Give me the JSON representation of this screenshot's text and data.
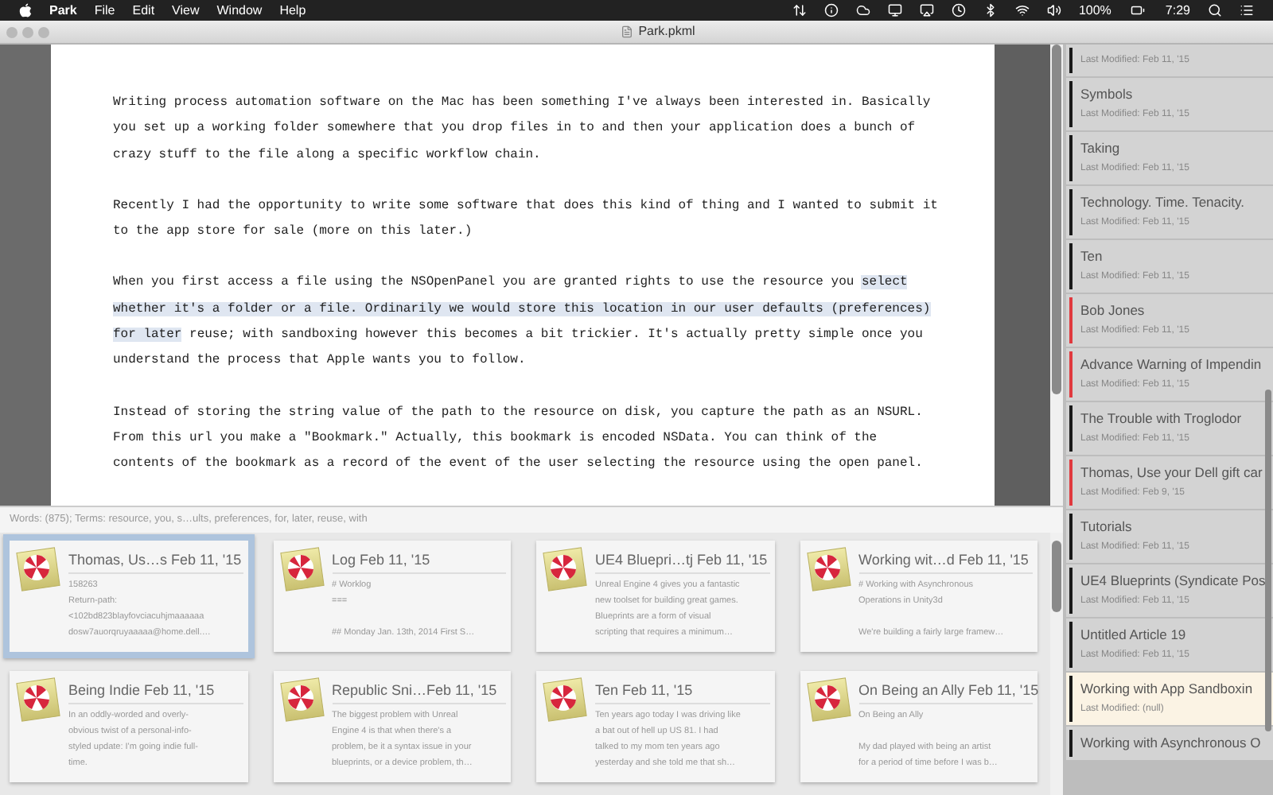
{
  "menu_bar": {
    "app_name": "Park",
    "menus": [
      "File",
      "Edit",
      "View",
      "Window",
      "Help"
    ],
    "battery": "100%",
    "clock": "7:29"
  },
  "window": {
    "title": "Park.pkml"
  },
  "editor": {
    "paragraphs": [
      [
        {
          "text": "Writing process automation software on the Mac has been something I've always been interested in. Basically you set up a working folder somewhere that you drop files in to and then your application does a bunch of crazy stuff to the file along a specific workflow chain.",
          "highlighted": false
        }
      ],
      [
        {
          "text": "Recently I had the opportunity to write some software that does this kind of thing and I wanted to submit it to the app store for sale (more on this later.)",
          "highlighted": false
        }
      ],
      [
        {
          "text": "When you first access a file using the NSOpenPanel you are granted rights to use the resource you ",
          "highlighted": false
        },
        {
          "text": "select whether it's a folder or a file. Ordinarily we would store this location in our user defaults (preferences) for later",
          "highlighted": true
        },
        {
          "text": " reuse; with sandboxing however this becomes a bit trickier. It's actually pretty simple once you understand the process that Apple wants you to follow.",
          "highlighted": false
        }
      ],
      [
        {
          "text": "Instead of storing the string value of the path to the resource on disk, you capture the path as an NSURL. From this url you make a \"Bookmark.\" Actually, this bookmark is encoded NSData. You can think of the contents of the bookmark as a record of the event of the user selecting the resource using the open panel.",
          "highlighted": false
        }
      ]
    ]
  },
  "status_bar": "Words: (875); Terms: resource, you, s…ults, preferences, for, later, reuse, with",
  "cards": [
    {
      "title": "Thomas, Us…s Feb 11, '15",
      "body": "158263\nReturn-path:\n<102bd823blayfovciacuhjmaaaaaa\ndosw7auorqruyaaaaa@home.dell.…",
      "selected": true
    },
    {
      "title": "Log Feb 11, '15",
      "body": "# Worklog\n===\n\n## Monday Jan. 13th, 2014 First S…",
      "selected": false
    },
    {
      "title": "UE4 Bluepri…tj Feb 11, '15",
      "body": "Unreal Engine 4 gives you a fantastic\nnew toolset for building great games.\nBlueprints are a form of visual\nscripting that requires a minimum…",
      "selected": false
    },
    {
      "title": "Working wit…d Feb 11, '15",
      "body": "# Working with Asynchronous\nOperations in Unity3d\n\nWe're building a fairly large framew…",
      "selected": false
    },
    {
      "title": "Being Indie Feb 11, '15",
      "body": "In an oddly-worded and overly-\nobvious twist of a personal-info-\nstyled update: I'm going indie full-\ntime.",
      "selected": false
    },
    {
      "title": "Republic Sni…Feb 11, '15",
      "body": "The biggest problem with Unreal\nEngine 4 is that when there's a\nproblem, be it a syntax issue in your\nblueprints, or a device problem, th…",
      "selected": false
    },
    {
      "title": "Ten Feb 11, '15",
      "body": "Ten years ago today I was driving like\na bat out of hell up US 81. I had\ntalked to my mom ten years ago\nyesterday and she told me that sh…",
      "selected": false
    },
    {
      "title": "On Being an Ally Feb 11, '15",
      "body": "On Being an Ally\n\nMy dad played with being an artist\nfor a period of time before I was b…",
      "selected": false
    }
  ],
  "sidebar": {
    "items": [
      {
        "modified": "Last Modified: Feb 11, '15",
        "color": "#1a1a1a",
        "selected": false
      },
      {
        "title": "Symbols",
        "modified": "Last Modified: Feb 11, '15",
        "color": "#1a1a1a",
        "selected": false
      },
      {
        "title": "Taking",
        "modified": "Last Modified: Feb 11, '15",
        "color": "#1a1a1a",
        "selected": false
      },
      {
        "title": "Technology. Time. Tenacity.",
        "modified": "Last Modified: Feb 11, '15",
        "color": "#1a1a1a",
        "selected": false
      },
      {
        "title": "Ten",
        "modified": "Last Modified: Feb 11, '15",
        "color": "#1a1a1a",
        "selected": false
      },
      {
        "title": "Bob Jones",
        "modified": "Last Modified: Feb 11, '15",
        "color": "#e0393e",
        "selected": false
      },
      {
        "title": "Advance Warning of Impendin",
        "modified": "Last Modified: Feb 11, '15",
        "color": "#e0393e",
        "selected": false
      },
      {
        "title": "The Trouble with Troglodor",
        "modified": "Last Modified: Feb 11, '15",
        "color": "#1a1a1a",
        "selected": false
      },
      {
        "title": "Thomas, Use your Dell gift car",
        "modified": "Last Modified: Feb 9, '15",
        "color": "#e0393e",
        "selected": false
      },
      {
        "title": "Tutorials",
        "modified": "Last Modified: Feb 11, '15",
        "color": "#1a1a1a",
        "selected": false
      },
      {
        "title": "UE4 Blueprints (Syndicate Pos",
        "modified": "Last Modified: Feb 11, '15",
        "color": "#1a1a1a",
        "selected": false
      },
      {
        "title": "Untitled Article 19",
        "modified": "Last Modified: Feb 11, '15",
        "color": "#1a1a1a",
        "selected": false
      },
      {
        "title": "Working with App Sandboxin",
        "modified": "Last Modified: (null)",
        "color": "#1a1a1a",
        "selected": true
      },
      {
        "title": "Working with Asynchronous O",
        "color": "#1a1a1a",
        "selected": false
      }
    ]
  }
}
